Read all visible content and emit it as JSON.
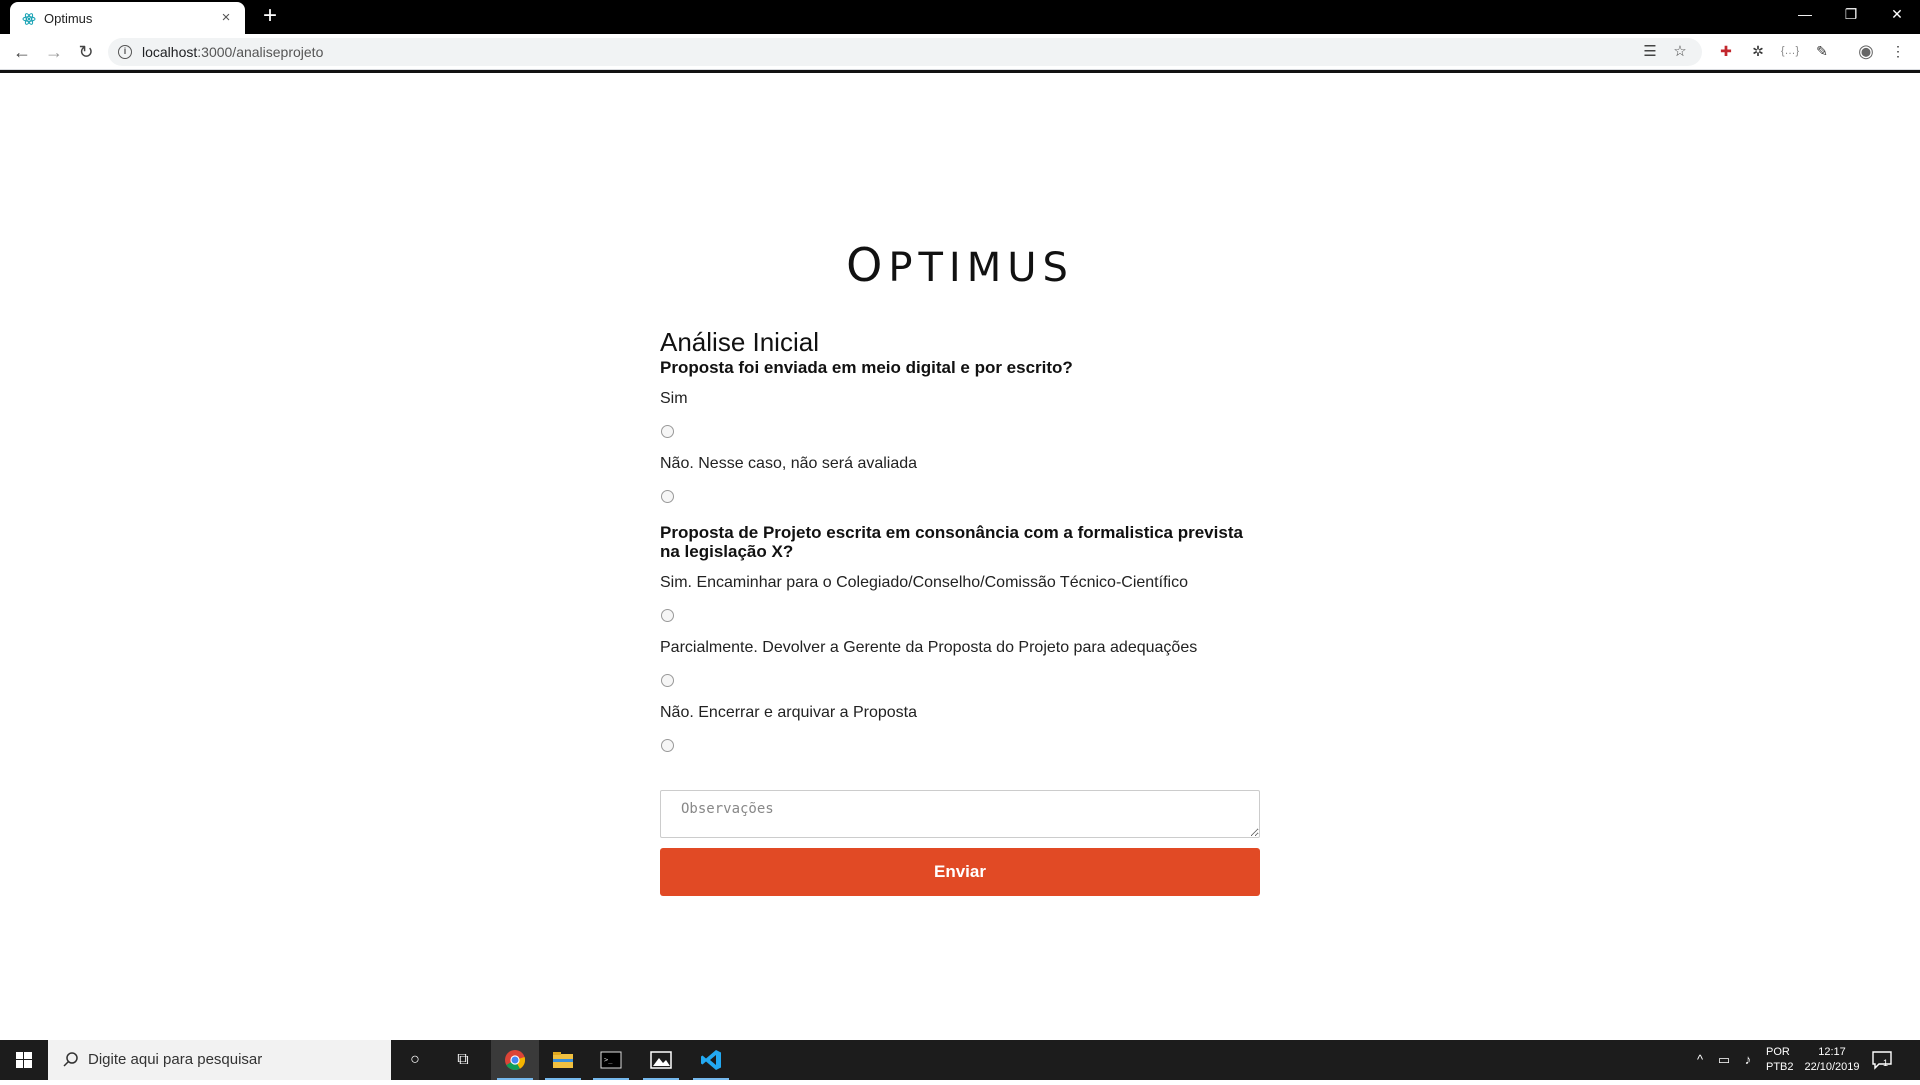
{
  "browser": {
    "tab_title": "Optimus",
    "tab_close": "×",
    "new_tab": "+",
    "url_host": "localhost",
    "url_rest": ":3000/analiseprojeto",
    "window_controls": {
      "minimize": "—",
      "restore": "❐",
      "close": "✕"
    },
    "accent": "#1aa3b5"
  },
  "page": {
    "logo_first": "O",
    "logo_rest": "PTIMUS",
    "form_title": "Análise Inicial",
    "q1": {
      "text": "Proposta foi enviada em meio digital e por escrito?",
      "options": [
        "Sim",
        "Não. Nesse caso, não será avaliada"
      ]
    },
    "q2": {
      "text": "Proposta de Projeto escrita em consonância com a formalistica prevista na legislação X?",
      "options": [
        "Sim. Encaminhar para o Colegiado/Conselho/Comissão Técnico-Científico",
        "Parcialmente. Devolver a Gerente da Proposta do Projeto para adequações",
        "Não. Encerrar e arquivar a Proposta"
      ]
    },
    "observations_placeholder": "Observações",
    "submit_label": "Enviar",
    "submit_color": "#e14a25"
  },
  "taskbar": {
    "search_placeholder": "Digite aqui para pesquisar",
    "lang_line1": "POR",
    "lang_line2": "PTB2",
    "time": "12:17",
    "date": "22/10/2019",
    "notification_count": "1"
  }
}
